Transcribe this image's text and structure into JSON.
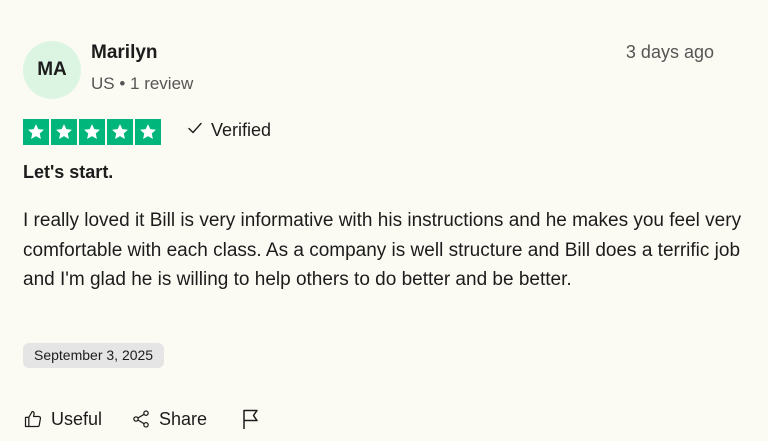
{
  "reviewer": {
    "initials": "MA",
    "name": "Marilyn",
    "meta": "US • 1 review"
  },
  "review": {
    "posted_ago": "3 days ago",
    "rating": 5,
    "rating_max": 5,
    "verified_label": "Verified",
    "title": "Let's start.",
    "body": "I really loved it Bill is very informative with his instructions and he makes you feel very comfortable with each class. As a company is well structure and Bill does a terrific job and I'm glad he is willing to help others to do better and be better.",
    "date_of_experience": "September 3, 2025"
  },
  "actions": {
    "useful_label": "Useful",
    "share_label": "Share"
  },
  "icons": {
    "star": "star-icon",
    "verified": "checkmark-icon",
    "useful": "thumbs-up-icon",
    "share": "share-icon",
    "report": "flag-icon"
  },
  "colors": {
    "star_bg": "#00b67a",
    "avatar_bg": "#dcf5e3",
    "page_bg": "#fcfbf3",
    "badge_bg": "#e5e5e5"
  }
}
